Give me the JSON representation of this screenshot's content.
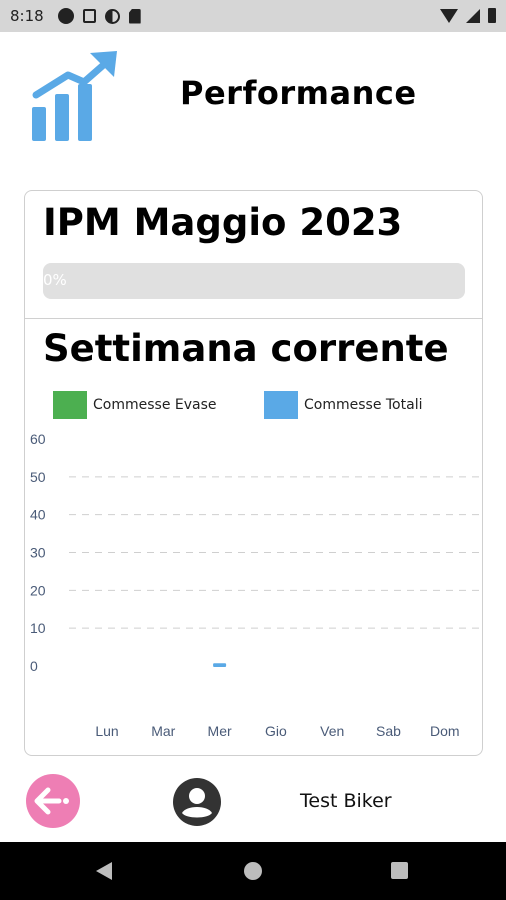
{
  "status_bar": {
    "time": "8:18",
    "icons_left": [
      "record-icon",
      "a-box-icon",
      "half-circle-icon",
      "sim-card-icon"
    ],
    "icons_right": [
      "wifi-icon",
      "signal-icon",
      "battery-icon"
    ]
  },
  "header": {
    "title": "Performance",
    "icon": "growth-chart-icon",
    "icon_color": "#5aa9e6"
  },
  "ipm": {
    "title": "IPM Maggio 2023",
    "progress_text": "0%",
    "progress_value": 0
  },
  "weekly": {
    "title": "Settimana corrente",
    "legend": [
      {
        "label": "Commesse Evase",
        "color": "#4caf50"
      },
      {
        "label": "Commesse Totali",
        "color": "#5aa9e6"
      }
    ]
  },
  "chart_data": {
    "type": "bar",
    "categories": [
      "Lun",
      "Mar",
      "Mer",
      "Gio",
      "Ven",
      "Sab",
      "Dom"
    ],
    "series": [
      {
        "name": "Commesse Evase",
        "color": "#4caf50",
        "values": [
          0,
          0,
          0,
          0,
          0,
          0,
          0
        ]
      },
      {
        "name": "Commesse Totali",
        "color": "#5aa9e6",
        "values": [
          0,
          0,
          1,
          0,
          0,
          0,
          0
        ]
      }
    ],
    "yticks": [
      0,
      10,
      20,
      30,
      40,
      50,
      60
    ],
    "ylim": [
      0,
      60
    ],
    "grid": true
  },
  "footer": {
    "back_icon": "arrow-left-icon",
    "back_color": "#ee7eb4",
    "avatar_icon": "account-circle-icon",
    "user_name": "Test Biker"
  },
  "navbar": {
    "buttons": [
      "back-triangle-icon",
      "home-circle-icon",
      "recents-square-icon"
    ]
  }
}
